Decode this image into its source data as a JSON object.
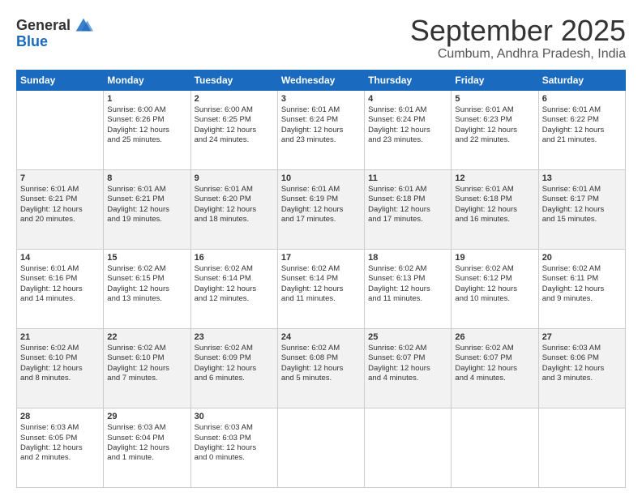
{
  "header": {
    "logo_general": "General",
    "logo_blue": "Blue",
    "month_title": "September 2025",
    "location": "Cumbum, Andhra Pradesh, India"
  },
  "days_of_week": [
    "Sunday",
    "Monday",
    "Tuesday",
    "Wednesday",
    "Thursday",
    "Friday",
    "Saturday"
  ],
  "weeks": [
    [
      {
        "day": "",
        "info": ""
      },
      {
        "day": "1",
        "info": "Sunrise: 6:00 AM\nSunset: 6:26 PM\nDaylight: 12 hours\nand 25 minutes."
      },
      {
        "day": "2",
        "info": "Sunrise: 6:00 AM\nSunset: 6:25 PM\nDaylight: 12 hours\nand 24 minutes."
      },
      {
        "day": "3",
        "info": "Sunrise: 6:01 AM\nSunset: 6:24 PM\nDaylight: 12 hours\nand 23 minutes."
      },
      {
        "day": "4",
        "info": "Sunrise: 6:01 AM\nSunset: 6:24 PM\nDaylight: 12 hours\nand 23 minutes."
      },
      {
        "day": "5",
        "info": "Sunrise: 6:01 AM\nSunset: 6:23 PM\nDaylight: 12 hours\nand 22 minutes."
      },
      {
        "day": "6",
        "info": "Sunrise: 6:01 AM\nSunset: 6:22 PM\nDaylight: 12 hours\nand 21 minutes."
      }
    ],
    [
      {
        "day": "7",
        "info": "Sunrise: 6:01 AM\nSunset: 6:21 PM\nDaylight: 12 hours\nand 20 minutes."
      },
      {
        "day": "8",
        "info": "Sunrise: 6:01 AM\nSunset: 6:21 PM\nDaylight: 12 hours\nand 19 minutes."
      },
      {
        "day": "9",
        "info": "Sunrise: 6:01 AM\nSunset: 6:20 PM\nDaylight: 12 hours\nand 18 minutes."
      },
      {
        "day": "10",
        "info": "Sunrise: 6:01 AM\nSunset: 6:19 PM\nDaylight: 12 hours\nand 17 minutes."
      },
      {
        "day": "11",
        "info": "Sunrise: 6:01 AM\nSunset: 6:18 PM\nDaylight: 12 hours\nand 17 minutes."
      },
      {
        "day": "12",
        "info": "Sunrise: 6:01 AM\nSunset: 6:18 PM\nDaylight: 12 hours\nand 16 minutes."
      },
      {
        "day": "13",
        "info": "Sunrise: 6:01 AM\nSunset: 6:17 PM\nDaylight: 12 hours\nand 15 minutes."
      }
    ],
    [
      {
        "day": "14",
        "info": "Sunrise: 6:01 AM\nSunset: 6:16 PM\nDaylight: 12 hours\nand 14 minutes."
      },
      {
        "day": "15",
        "info": "Sunrise: 6:02 AM\nSunset: 6:15 PM\nDaylight: 12 hours\nand 13 minutes."
      },
      {
        "day": "16",
        "info": "Sunrise: 6:02 AM\nSunset: 6:14 PM\nDaylight: 12 hours\nand 12 minutes."
      },
      {
        "day": "17",
        "info": "Sunrise: 6:02 AM\nSunset: 6:14 PM\nDaylight: 12 hours\nand 11 minutes."
      },
      {
        "day": "18",
        "info": "Sunrise: 6:02 AM\nSunset: 6:13 PM\nDaylight: 12 hours\nand 11 minutes."
      },
      {
        "day": "19",
        "info": "Sunrise: 6:02 AM\nSunset: 6:12 PM\nDaylight: 12 hours\nand 10 minutes."
      },
      {
        "day": "20",
        "info": "Sunrise: 6:02 AM\nSunset: 6:11 PM\nDaylight: 12 hours\nand 9 minutes."
      }
    ],
    [
      {
        "day": "21",
        "info": "Sunrise: 6:02 AM\nSunset: 6:10 PM\nDaylight: 12 hours\nand 8 minutes."
      },
      {
        "day": "22",
        "info": "Sunrise: 6:02 AM\nSunset: 6:10 PM\nDaylight: 12 hours\nand 7 minutes."
      },
      {
        "day": "23",
        "info": "Sunrise: 6:02 AM\nSunset: 6:09 PM\nDaylight: 12 hours\nand 6 minutes."
      },
      {
        "day": "24",
        "info": "Sunrise: 6:02 AM\nSunset: 6:08 PM\nDaylight: 12 hours\nand 5 minutes."
      },
      {
        "day": "25",
        "info": "Sunrise: 6:02 AM\nSunset: 6:07 PM\nDaylight: 12 hours\nand 4 minutes."
      },
      {
        "day": "26",
        "info": "Sunrise: 6:02 AM\nSunset: 6:07 PM\nDaylight: 12 hours\nand 4 minutes."
      },
      {
        "day": "27",
        "info": "Sunrise: 6:03 AM\nSunset: 6:06 PM\nDaylight: 12 hours\nand 3 minutes."
      }
    ],
    [
      {
        "day": "28",
        "info": "Sunrise: 6:03 AM\nSunset: 6:05 PM\nDaylight: 12 hours\nand 2 minutes."
      },
      {
        "day": "29",
        "info": "Sunrise: 6:03 AM\nSunset: 6:04 PM\nDaylight: 12 hours\nand 1 minute."
      },
      {
        "day": "30",
        "info": "Sunrise: 6:03 AM\nSunset: 6:03 PM\nDaylight: 12 hours\nand 0 minutes."
      },
      {
        "day": "",
        "info": ""
      },
      {
        "day": "",
        "info": ""
      },
      {
        "day": "",
        "info": ""
      },
      {
        "day": "",
        "info": ""
      }
    ]
  ]
}
